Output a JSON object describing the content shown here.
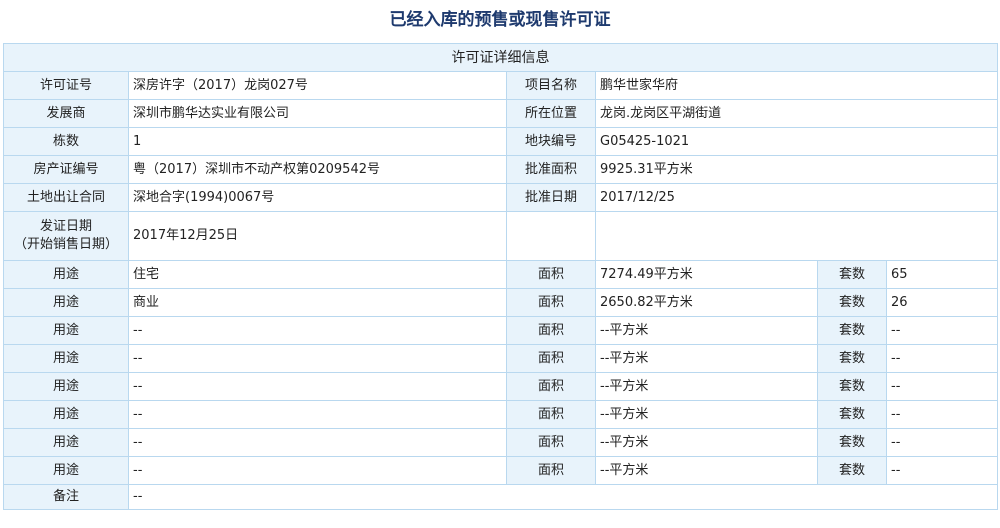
{
  "page_title": "已经入库的预售或现售许可证",
  "table_title": "许可证详细信息",
  "info": {
    "permit_no_label": "许可证号",
    "permit_no": "深房许字（2017）龙岗027号",
    "project_label": "项目名称",
    "project": "鹏华世家华府",
    "developer_label": "发展商",
    "developer": "深圳市鹏华达实业有限公司",
    "location_label": "所在位置",
    "location": "龙岗.龙岗区平湖街道",
    "buildings_label": "栋数",
    "buildings": "1",
    "plot_label": "地块编号",
    "plot": "G05425-1021",
    "cert_label": "房产证编号",
    "cert": "粤（2017）深圳市不动产权第0209542号",
    "area_label": "批准面积",
    "area": "9925.31平方米",
    "contract_label": "土地出让合同",
    "contract": "深地合字(1994)0067号",
    "approval_date_label": "批准日期",
    "approval_date": "2017/12/25",
    "issue_date_label_1": "发证日期",
    "issue_date_label_2": "（开始销售日期）",
    "issue_date": "2017年12月25日"
  },
  "usage_rows": [
    {
      "use_label": "用途",
      "use": "住宅",
      "area_label": "面积",
      "area": "7274.49平方米",
      "units_label": "套数",
      "units": "65"
    },
    {
      "use_label": "用途",
      "use": "商业",
      "area_label": "面积",
      "area": "2650.82平方米",
      "units_label": "套数",
      "units": "26"
    },
    {
      "use_label": "用途",
      "use": "--",
      "area_label": "面积",
      "area": "--平方米",
      "units_label": "套数",
      "units": "--"
    },
    {
      "use_label": "用途",
      "use": "--",
      "area_label": "面积",
      "area": "--平方米",
      "units_label": "套数",
      "units": "--"
    },
    {
      "use_label": "用途",
      "use": "--",
      "area_label": "面积",
      "area": "--平方米",
      "units_label": "套数",
      "units": "--"
    },
    {
      "use_label": "用途",
      "use": "--",
      "area_label": "面积",
      "area": "--平方米",
      "units_label": "套数",
      "units": "--"
    },
    {
      "use_label": "用途",
      "use": "--",
      "area_label": "面积",
      "area": "--平方米",
      "units_label": "套数",
      "units": "--"
    },
    {
      "use_label": "用途",
      "use": "--",
      "area_label": "面积",
      "area": "--平方米",
      "units_label": "套数",
      "units": "--"
    }
  ],
  "remark_label": "备注",
  "remark": "--"
}
